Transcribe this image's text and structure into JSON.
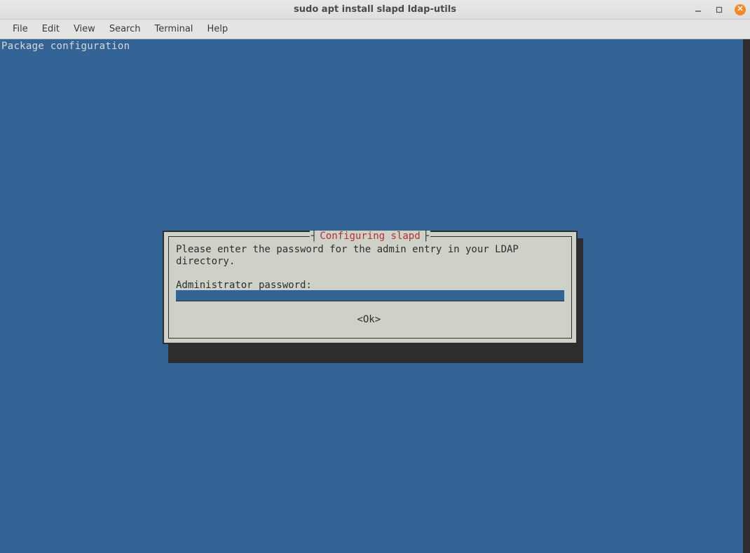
{
  "window": {
    "title": "sudo apt install slapd ldap-utils"
  },
  "menubar": {
    "file": "File",
    "edit": "Edit",
    "view": "View",
    "search": "Search",
    "terminal": "Terminal",
    "help": "Help"
  },
  "terminal": {
    "header": "Package configuration"
  },
  "dialog": {
    "title": "Configuring slapd",
    "message": "Please enter the password for the admin entry in your LDAP directory.",
    "prompt": "Administrator password:",
    "password_value": "",
    "ok_label": "<Ok>"
  }
}
